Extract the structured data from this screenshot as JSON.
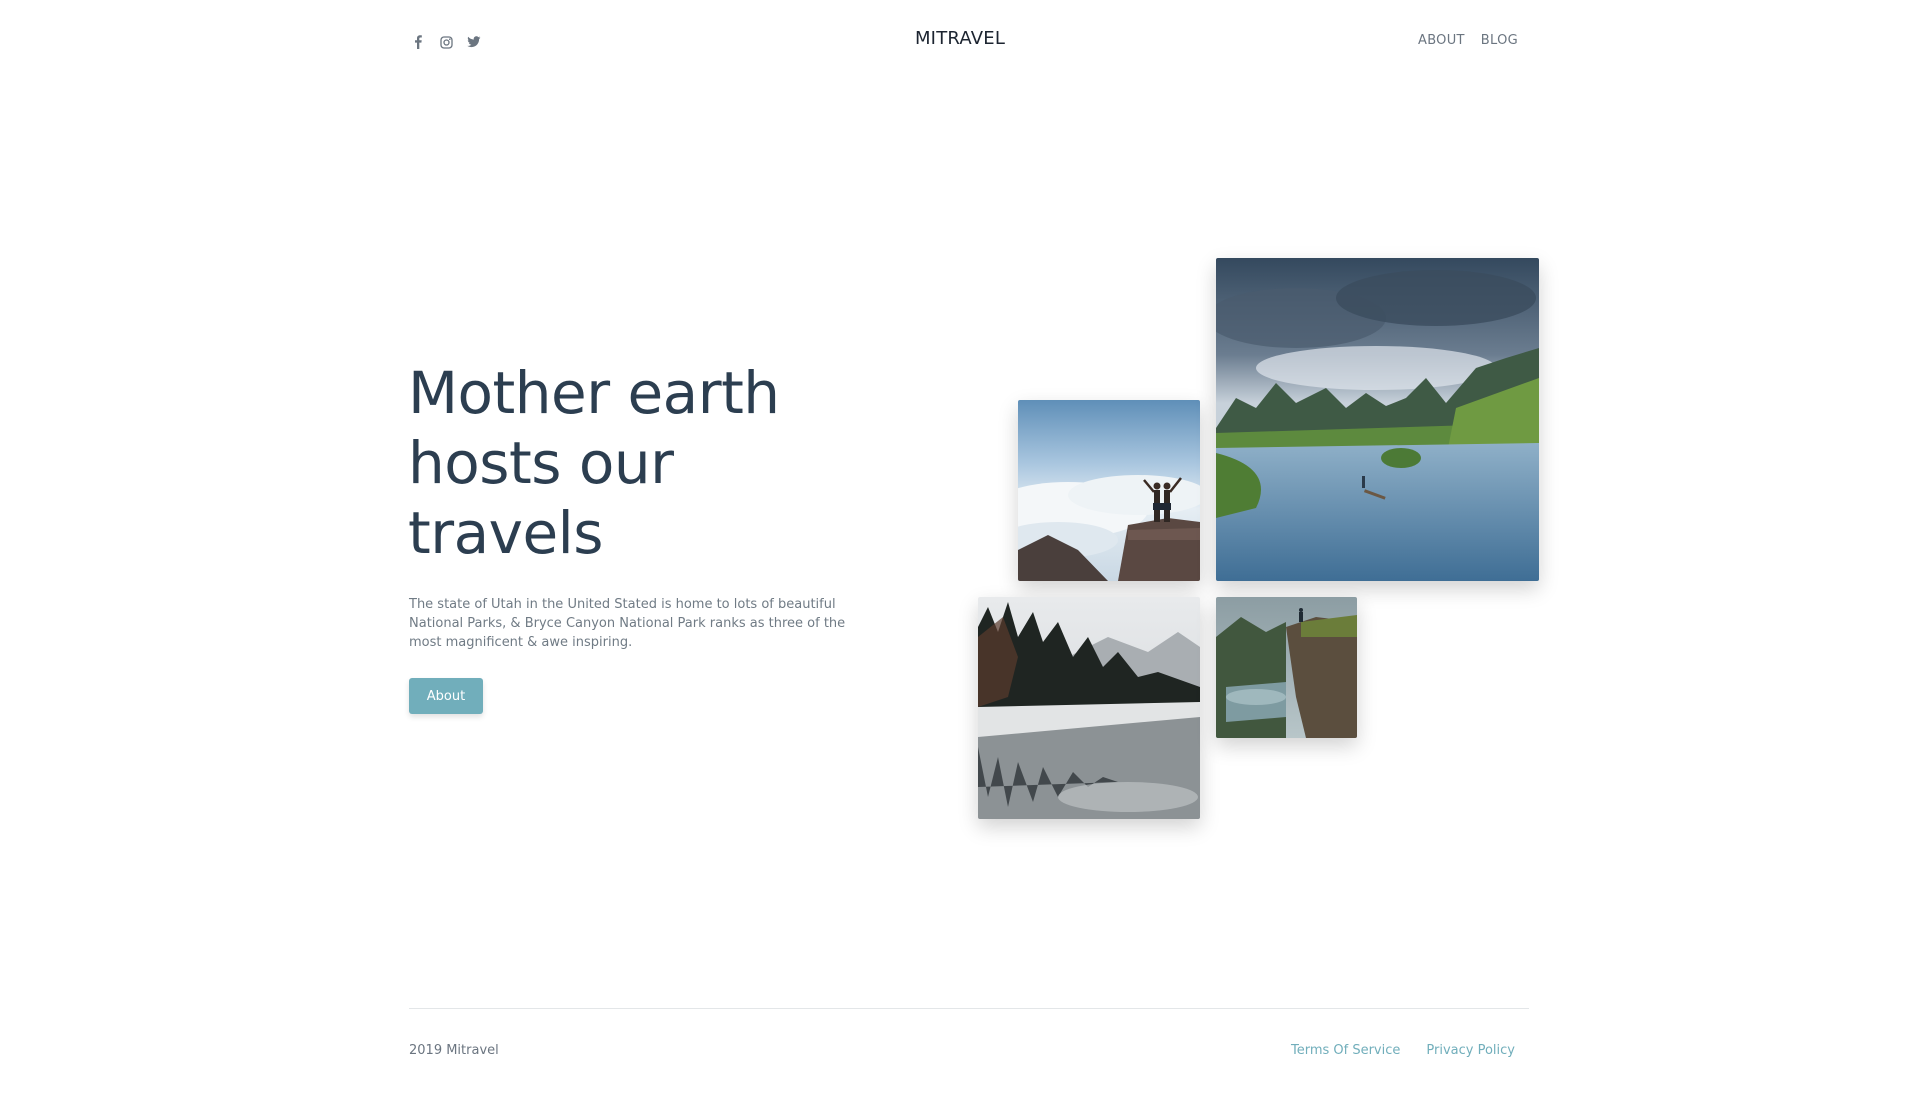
{
  "header": {
    "brand": "MITRAVEL",
    "social_icons": [
      "facebook-icon",
      "instagram-icon",
      "twitter-icon"
    ],
    "nav": [
      {
        "label": "ABOUT"
      },
      {
        "label": "BLOG"
      }
    ]
  },
  "hero": {
    "title_lines": [
      "Mother earth",
      "hosts our",
      "travels"
    ],
    "description": "The state of Utah in the United Stated is home to lots of beautiful National Parks, & Bryce Canyon National Park ranks as three of the most magnificent & awe inspiring.",
    "button_label": "About"
  },
  "gallery": [
    {
      "name": "couple-on-cliff-photo"
    },
    {
      "name": "river-valley-photo"
    },
    {
      "name": "forest-lake-photo"
    },
    {
      "name": "cliff-overlook-photo"
    }
  ],
  "footer": {
    "copyright": "2019 Mitravel",
    "links": [
      {
        "label": "Terms Of Service"
      },
      {
        "label": "Privacy Policy"
      }
    ]
  },
  "colors": {
    "accent": "#71aebb",
    "heading": "#2c3e50",
    "muted_text": "#707b85",
    "background": "#ffffff"
  }
}
